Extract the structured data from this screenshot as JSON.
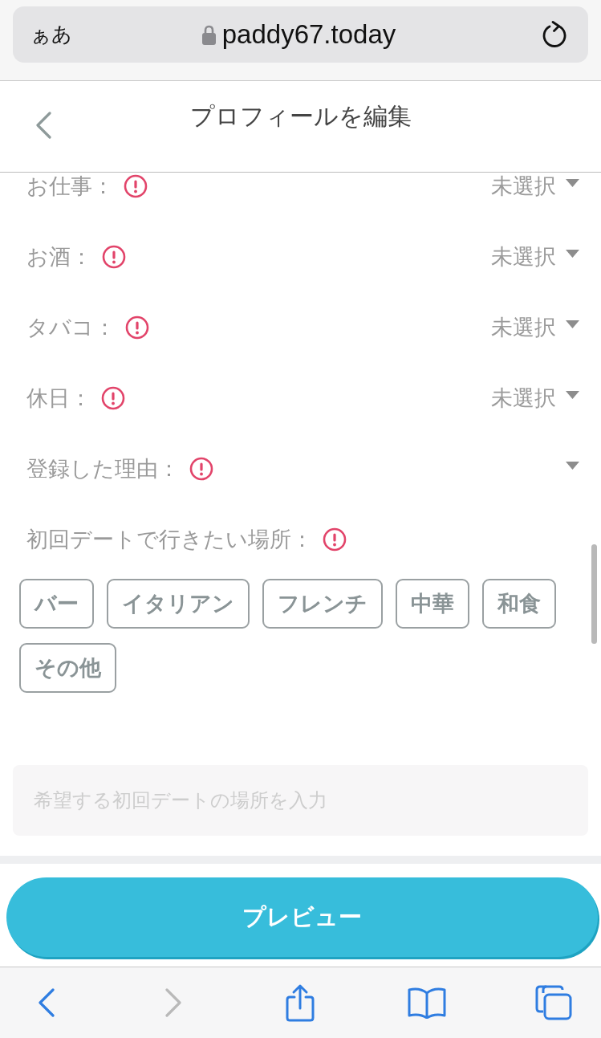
{
  "browser_bar": {
    "text_size_button": "ぁあ",
    "url": "paddy67.today"
  },
  "header": {
    "title": "プロフィールを編集"
  },
  "fields": [
    {
      "label": "お仕事：",
      "required": true,
      "value": "未選択"
    },
    {
      "label": "お酒：",
      "required": true,
      "value": "未選択"
    },
    {
      "label": "タバコ：",
      "required": true,
      "value": "未選択"
    },
    {
      "label": "休日：",
      "required": true,
      "value": "未選択"
    },
    {
      "label": "登録した理由：",
      "required": true
    }
  ],
  "date_place": {
    "label": "初回デートで行きたい場所：",
    "required": true,
    "options": [
      {
        "label": "バー",
        "selected": false
      },
      {
        "label": "イタリアン",
        "selected": false
      },
      {
        "label": "フレンチ",
        "selected": false
      },
      {
        "label": "中華",
        "selected": false
      },
      {
        "label": "和食",
        "selected": false
      },
      {
        "label": "その他",
        "selected": false
      }
    ]
  },
  "place_input": {
    "placeholder": "希望する初回デートの場所を入力"
  },
  "preview_button": "プレビュー",
  "toolbar": [
    {
      "kind": "back",
      "disabled": false
    },
    {
      "kind": "forward",
      "disabled": true
    },
    {
      "kind": "share",
      "disabled": false
    },
    {
      "kind": "bookmarks",
      "disabled": false
    },
    {
      "kind": "tabs",
      "disabled": false
    }
  ]
}
